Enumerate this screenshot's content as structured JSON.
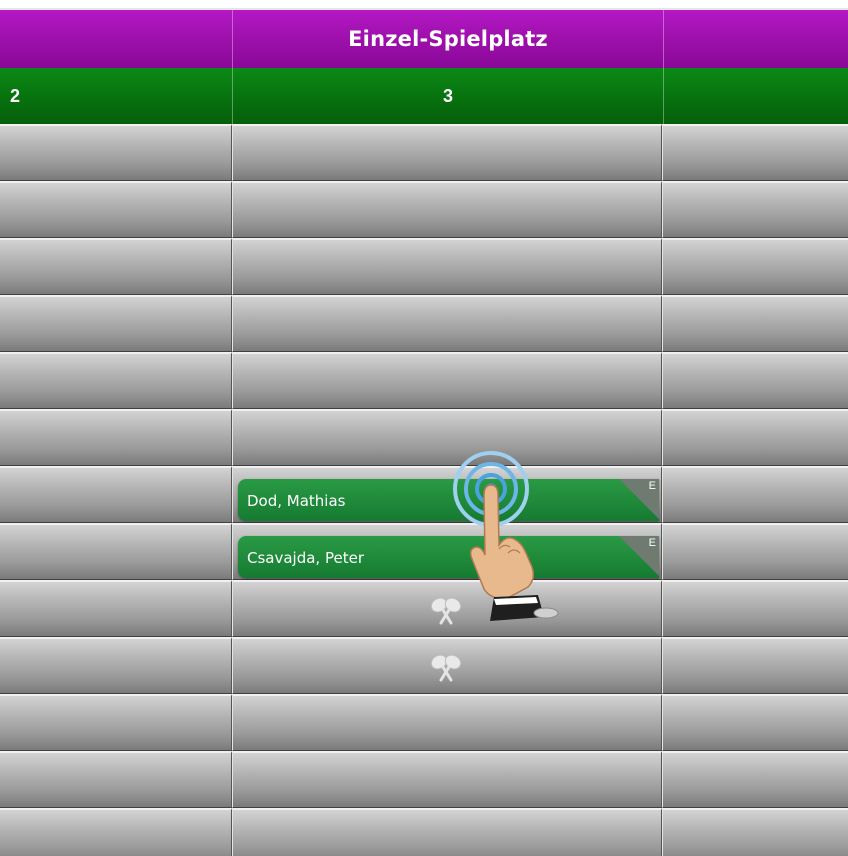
{
  "header": {
    "court_title": "Einzel-Spielplatz"
  },
  "columns": {
    "left_number": "2",
    "center_number": "3",
    "right_number": ""
  },
  "bookings": [
    {
      "name": "Dod, Mathias",
      "type": "E"
    },
    {
      "name": "Csavajda, Peter",
      "type": "E"
    }
  ],
  "icons": {
    "racket": "crossed-rackets-icon",
    "pointer": "tap-hand-pointer-icon"
  },
  "colors": {
    "header_purple": "#a012b0",
    "number_green": "#077a10",
    "booking_green": "#1f8c3b",
    "slot_gray": "#a5a5a5"
  }
}
